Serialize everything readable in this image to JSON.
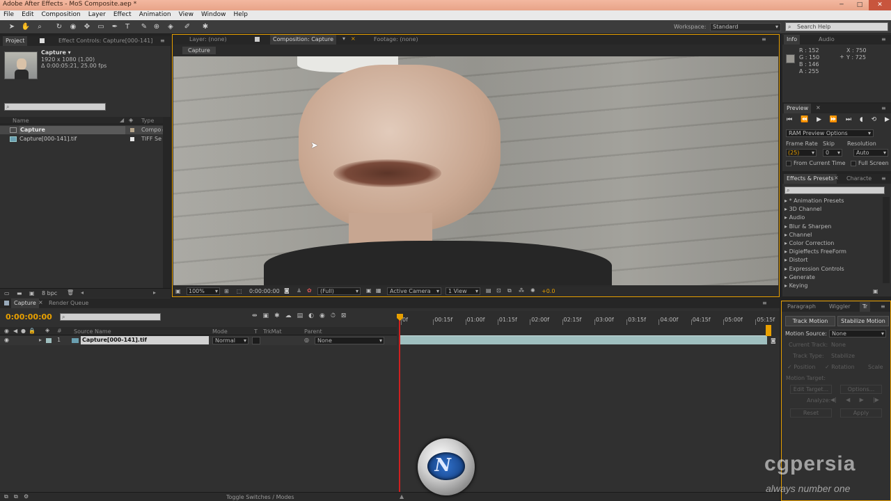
{
  "app": {
    "title": "Adobe After Effects - MoS Composite.aep *"
  },
  "window_controls": {
    "minimize": "─",
    "maximize": "□",
    "close": "✕"
  },
  "menu": [
    "File",
    "Edit",
    "Composition",
    "Layer",
    "Effect",
    "Animation",
    "View",
    "Window",
    "Help"
  ],
  "toolbar": {
    "tools": [
      "selection-tool",
      "hand-tool",
      "zoom-tool",
      "rotate-tool",
      "camera-tool",
      "pan-behind-tool",
      "rectangle-tool",
      "pen-tool",
      "type-tool",
      "brush-tool",
      "clone-stamp-tool",
      "eraser-tool",
      "roto-brush-tool",
      "puppet-pin-tool"
    ],
    "workspace_label": "Workspace:",
    "workspace_value": "Standard",
    "search_placeholder": "Search Help"
  },
  "project": {
    "tab_project": "Project",
    "tab_effect_controls": "Effect Controls: Capture[000-141]",
    "item_name": "Capture ▾",
    "item_dims": "1920 x 1080 (1.00)",
    "item_duration": "Δ 0:00:05:21, 25.00 fps",
    "col_name": "Name",
    "col_type": "Type",
    "rows": [
      {
        "name": "Capture",
        "type": "Compo"
      },
      {
        "name": "Capture[000-141].tif",
        "type": "TIFF Se"
      }
    ],
    "bpc": "8 bpc"
  },
  "viewer": {
    "tab_layer": "Layer: (none)",
    "tab_comp": "Composition: Capture",
    "tab_footage": "Footage: (none)",
    "breadcrumb": "Capture",
    "zoom": "100%",
    "timecode": "0:00:00:00",
    "resolution": "(Full)",
    "camera": "Active Camera",
    "views": "1 View",
    "exposure": "+0.0"
  },
  "info": {
    "tab_info": "Info",
    "tab_audio": "Audio",
    "r": "R : 152",
    "g": "G : 150",
    "b": "B : 146",
    "a": "A : 255",
    "x": "X : 750",
    "y": "Y : 725"
  },
  "preview": {
    "tab": "Preview",
    "ram_options": "RAM Preview Options",
    "frame_rate_label": "Frame Rate",
    "skip_label": "Skip",
    "resolution_label": "Resolution",
    "frame_rate_value": "(25)",
    "skip_value": "0",
    "resolution_value": "Auto",
    "from_current": "From Current Time",
    "full_screen": "Full Screen"
  },
  "effects": {
    "tab": "Effects & Presets",
    "tab_character": "Characte",
    "items": [
      "* Animation Presets",
      "3D Channel",
      "Audio",
      "Blur & Sharpen",
      "Channel",
      "Color Correction",
      "Digieffects FreeForm",
      "Distort",
      "Expression Controls",
      "Generate",
      "Keying"
    ]
  },
  "timeline": {
    "tab_capture": "Capture",
    "tab_render": "Render Queue",
    "timecode": "0:00:00:00",
    "col_source": "Source Name",
    "col_mode": "Mode",
    "col_t": "T",
    "col_trkmat": "TrkMat",
    "col_parent": "Parent",
    "ruler": [
      "0f",
      "00:15f",
      "01:00f",
      "01:15f",
      "02:00f",
      "02:15f",
      "03:00f",
      "03:15f",
      "04:00f",
      "04:15f",
      "05:00f",
      "05:15f"
    ],
    "layer": {
      "num": "1",
      "name": "Capture[000-141].tif",
      "mode": "Normal",
      "parent": "None"
    },
    "toggle": "Toggle Switches / Modes"
  },
  "tracker": {
    "tab_paragraph": "Paragraph",
    "tab_wiggler": "Wiggler",
    "tab_tracker": "Tr",
    "track_motion": "Track Motion",
    "stabilize_motion": "Stabilize Motion",
    "motion_source_label": "Motion Source:",
    "motion_source_value": "None",
    "current_track_label": "Current Track:",
    "current_track_value": "None",
    "track_type_label": "Track Type:",
    "track_type_value": "Stabilize",
    "position": "Position",
    "rotation": "Rotation",
    "scale": "Scale",
    "motion_target": "Motion Target:",
    "edit_target": "Edit Target...",
    "options": "Options...",
    "analyze": "Analyze:",
    "reset": "Reset",
    "apply": "Apply"
  },
  "watermark": {
    "brand": "cgpersia",
    "tagline": "always number one"
  },
  "colors": {
    "accent": "#e8a000",
    "titlebar": "#eab096",
    "playhead": "#d02020",
    "layer_bar": "#9fbfbf"
  }
}
